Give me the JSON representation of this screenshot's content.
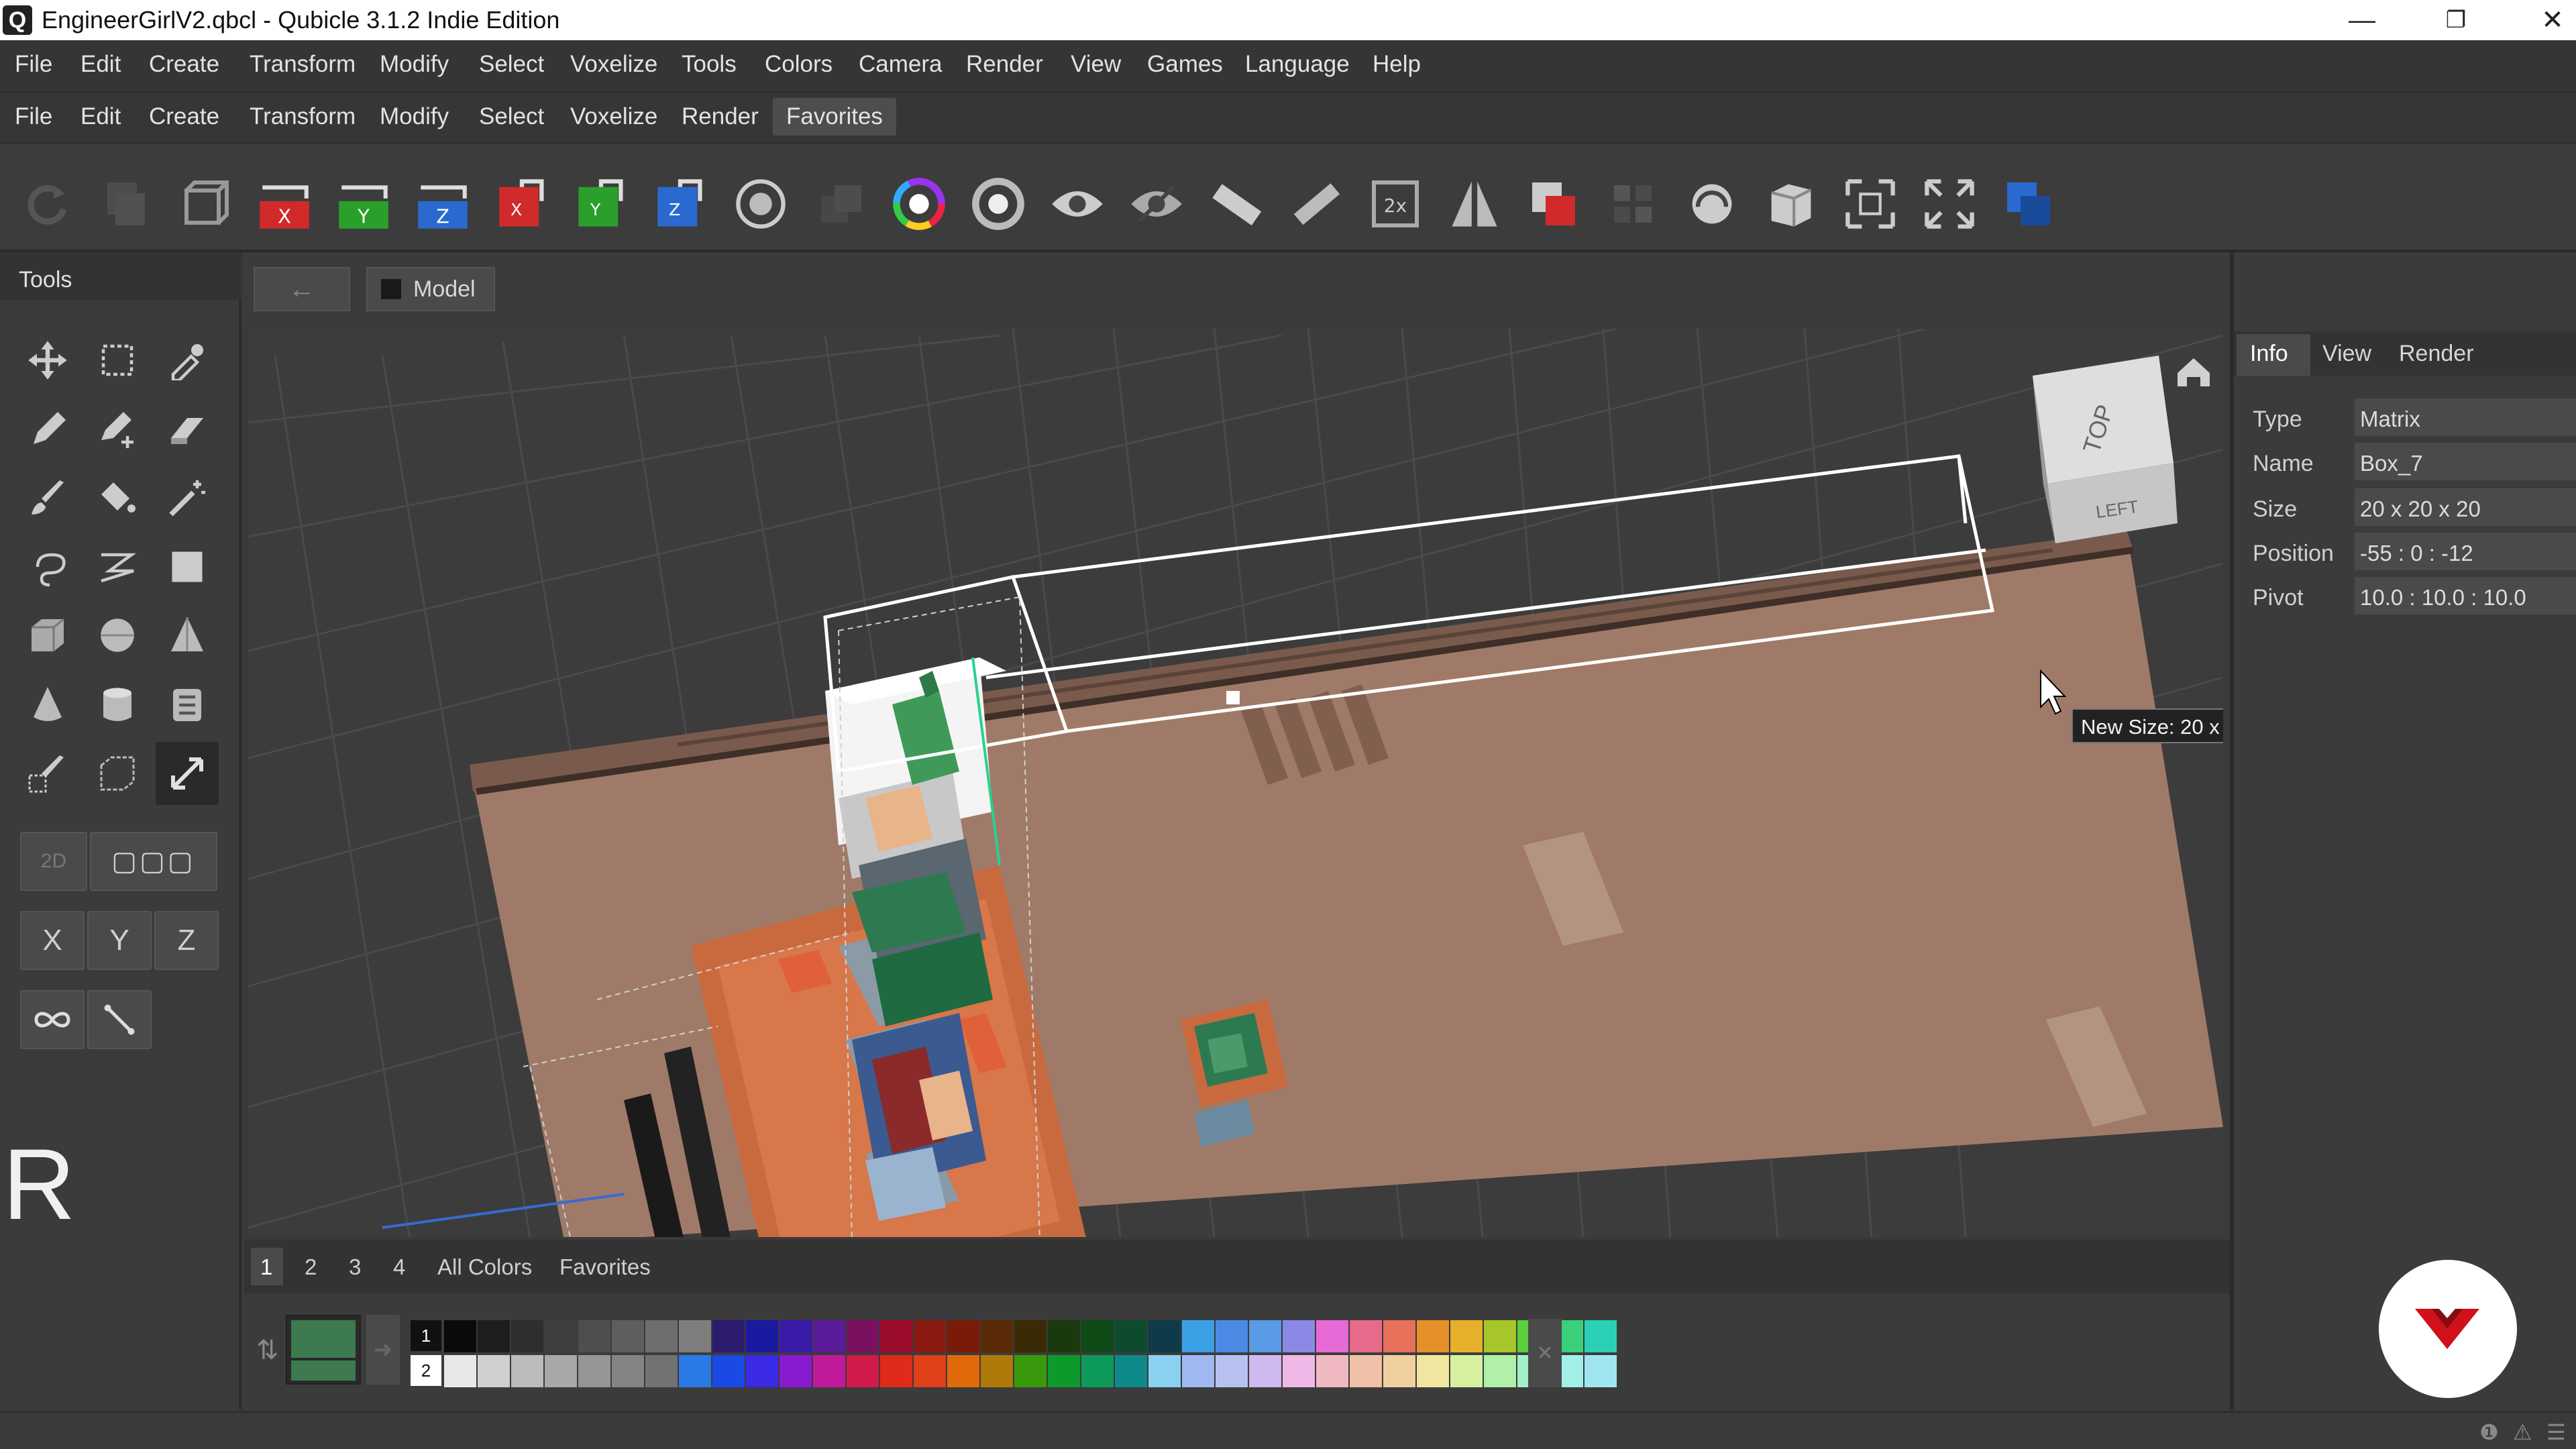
{
  "window": {
    "title": "EngineerGirlV2.qbcl - Qubicle 3.1.2 Indie Edition",
    "app_icon_letter": "Q",
    "minimize": "—",
    "restore": "❐",
    "close": "✕"
  },
  "menu_main": [
    "File",
    "Edit",
    "Create",
    "Transform",
    "Modify",
    "Select",
    "Voxelize",
    "Tools",
    "Colors",
    "Camera",
    "Render",
    "View",
    "Games",
    "Language",
    "Help"
  ],
  "menu_secondary": [
    "File",
    "Edit",
    "Create",
    "Transform",
    "Modify",
    "Select",
    "Voxelize",
    "Render",
    "Favorites"
  ],
  "tools": {
    "header": "Tools",
    "mode_2d": "2D",
    "mode_3d": "▢▢▢",
    "axis": [
      "X",
      "Y",
      "Z"
    ],
    "key_hint": "R"
  },
  "viewport": {
    "back_arrow": "←",
    "breadcrumb": "Model",
    "cube_top": "TOP",
    "cube_left": "LEFT",
    "tooltip": "New Size: 20 x"
  },
  "info_panel": {
    "tabs": [
      "Info",
      "View",
      "Render"
    ],
    "props": [
      {
        "label": "Type",
        "value": "Matrix"
      },
      {
        "label": "Name",
        "value": "Box_7"
      },
      {
        "label": "Size",
        "value": "20 x 20 x 20"
      },
      {
        "label": "Position",
        "value": "-55 : 0 : -12"
      },
      {
        "label": "Pivot",
        "value": "10.0 : 10.0 : 10.0"
      }
    ]
  },
  "palette": {
    "tabs": [
      "1",
      "2",
      "3",
      "4",
      "All Colors",
      "Favorites"
    ],
    "row_labels": [
      "1",
      "2"
    ],
    "row1": [
      "#0a0a0a",
      "#1e1e1e",
      "#2e2e2e",
      "#3e3e3e",
      "#4e4e4e",
      "#5e5e5e",
      "#6e6e6e",
      "#7e7e7e",
      "#2d1b6e",
      "#1a1aa0",
      "#3a1aa8",
      "#5a1a9a",
      "#7a1060",
      "#9a0c2a",
      "#8a1a10",
      "#7a1a08",
      "#5a2a06",
      "#3a2a06",
      "#1a3a0e",
      "#0e4a16",
      "#0e4a2e",
      "#0e3a4a",
      "#3aa0e6",
      "#4a8ae6",
      "#5a9ae6",
      "#8a8ae6",
      "#e66ad6",
      "#e66a8a",
      "#e6705a",
      "#e6902a",
      "#e6b02a",
      "#a6c62a",
      "#5ad03a",
      "#3ad07a",
      "#2ad0b6"
    ],
    "row2": [
      "#e8e8e8",
      "#d0d0d0",
      "#bcbcbc",
      "#a8a8a8",
      "#969696",
      "#848484",
      "#727272",
      "#2a7ae6",
      "#1a4ae6",
      "#3a2ae6",
      "#8a1ad0",
      "#c01a9a",
      "#d01a4a",
      "#e02a1a",
      "#e0401a",
      "#e06a0a",
      "#b07a0a",
      "#3a9a0e",
      "#0e9a2a",
      "#0e9a5a",
      "#0e8a8a",
      "#8ad0f0",
      "#a0b8f0",
      "#b8c0f0",
      "#d0b8f0",
      "#f0b8e6",
      "#f0b8c0",
      "#f0c0a8",
      "#f0d0a0",
      "#f0e6a0",
      "#d6f0a0",
      "#b0f0a8",
      "#a0f0c8",
      "#a0f0e6",
      "#a0e6f0"
    ],
    "current_color": "#3d7a4f"
  },
  "colors": {
    "accent": "#4a7ad0",
    "selection": "#ffffff",
    "floor": "#a07a68"
  }
}
